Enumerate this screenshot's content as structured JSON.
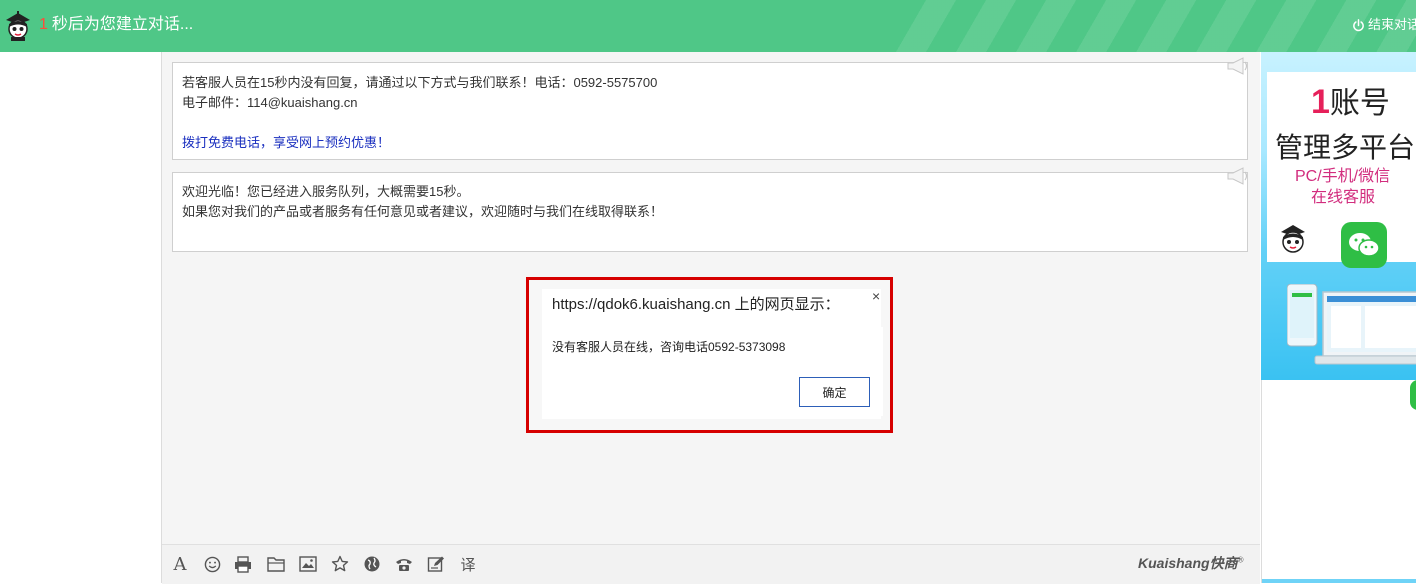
{
  "header": {
    "countdown_number": "1",
    "countdown_text": "秒后为您建立对话...",
    "end_chat_label": "结束对话",
    "end_chat_icon": "power-icon",
    "bg_color": "#4fc787"
  },
  "messages": [
    {
      "lines": [
        "若客服人员在15秒内没有回复，请通过以下方式与我们联系！电话：0592-5575700",
        "电子邮件：114@kuaishang.cn",
        "",
        "拨打免费电话，享受网上预约优惠！"
      ]
    },
    {
      "lines": [
        "欢迎光临！您已经进入服务队列，大概需要15秒。",
        "如果您对我们的产品或者服务有任何意见或者建议，欢迎随时与我们在线取得联系！"
      ]
    }
  ],
  "dialog": {
    "title": "https://qdok6.kuaishang.cn 上的网页显示：",
    "message": "没有客服人员在线，咨询电话0592-5373098",
    "ok_label": "确定",
    "close_label": "×"
  },
  "toolbar": {
    "icons": [
      "font-icon",
      "emoji-icon",
      "print-icon",
      "folder-icon",
      "image-icon",
      "star-icon",
      "globe-icon",
      "phone-icon",
      "edit-icon",
      "translate-icon"
    ],
    "translate_label": "译",
    "font_label": "A",
    "brand": "Kuaishang快商",
    "brand_mark": "®"
  },
  "ad": {
    "num": "1",
    "line1": "账号",
    "line2": "管理多平台",
    "line3": "PC/手机/微信",
    "line4": "在线客服"
  }
}
